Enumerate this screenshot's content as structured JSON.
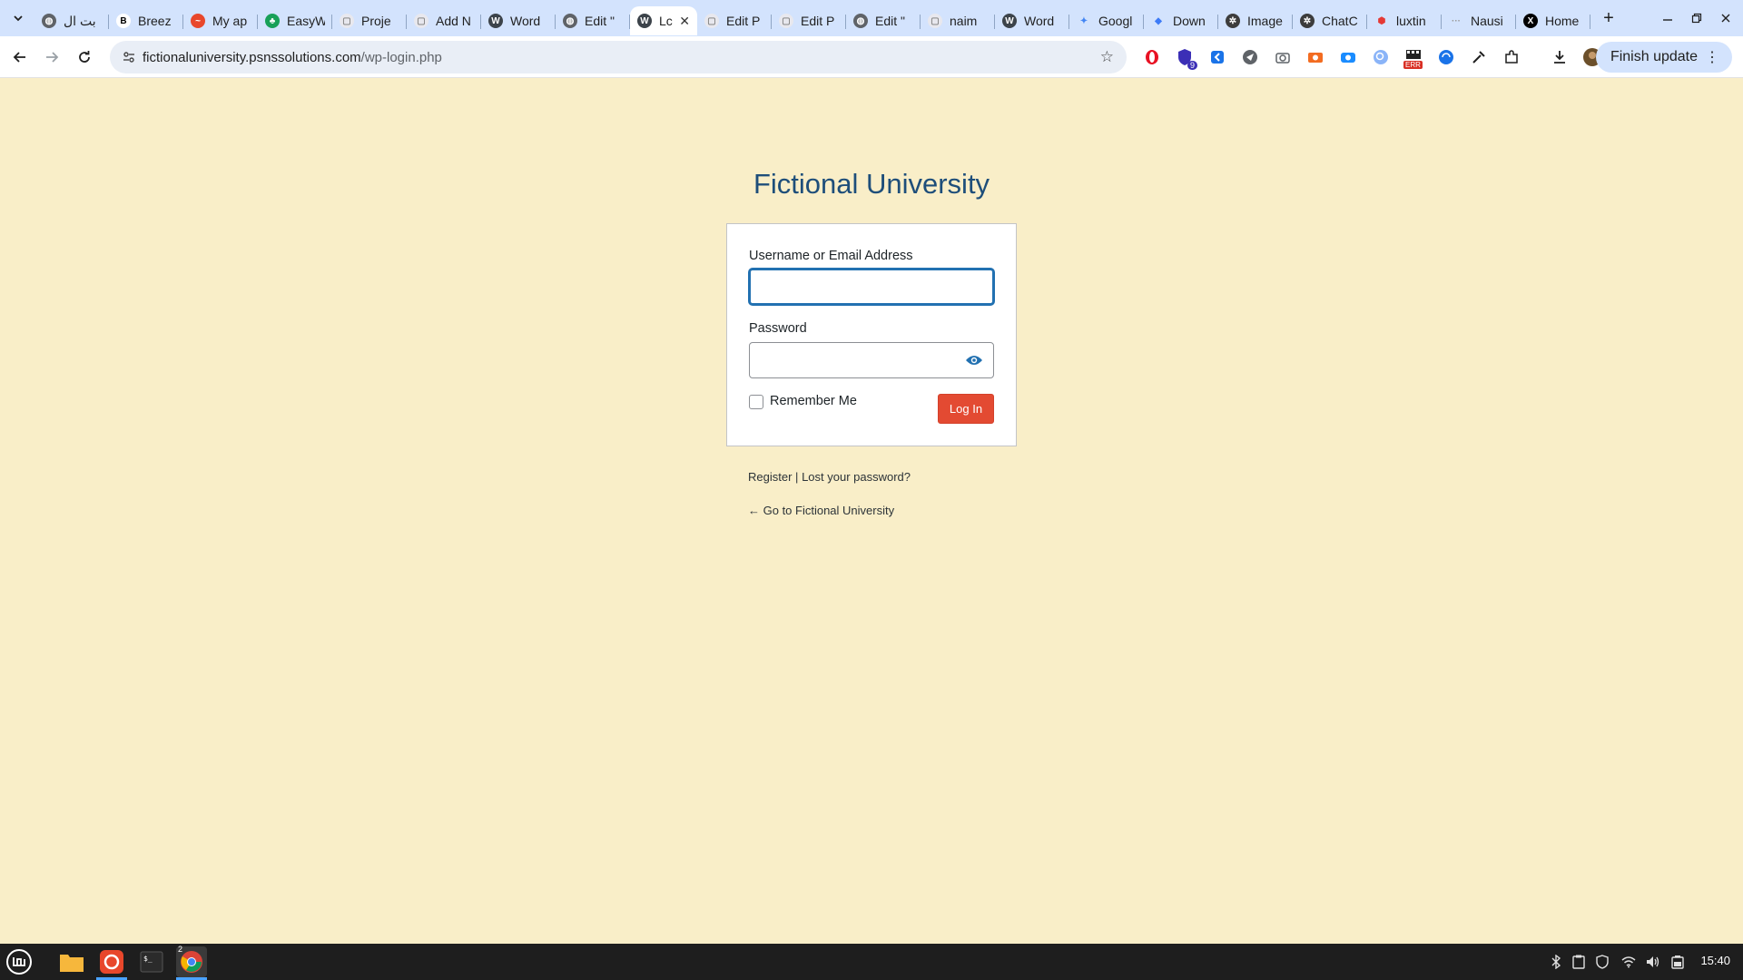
{
  "browser": {
    "tabs": [
      {
        "label": "بت ال",
        "favicon": "globe-icon"
      },
      {
        "label": "Breez",
        "favicon": "b-icon"
      },
      {
        "label": "My ap",
        "favicon": "m-icon"
      },
      {
        "label": "EasyW",
        "favicon": "octopus-icon"
      },
      {
        "label": "Proje",
        "favicon": "page-icon"
      },
      {
        "label": "Add N",
        "favicon": "page-icon"
      },
      {
        "label": "Word",
        "favicon": "wordpress-icon"
      },
      {
        "label": "Edit \"",
        "favicon": "globe-icon"
      },
      {
        "label": "Lc",
        "favicon": "wordpress-icon",
        "active": true
      },
      {
        "label": "Edit P",
        "favicon": "page-icon"
      },
      {
        "label": "Edit P",
        "favicon": "page-icon"
      },
      {
        "label": "Edit \"",
        "favicon": "globe-icon"
      },
      {
        "label": "naim",
        "favicon": "page-icon"
      },
      {
        "label": "Word",
        "favicon": "wordpress-icon"
      },
      {
        "label": "Googl",
        "favicon": "gemini-icon"
      },
      {
        "label": "Down",
        "favicon": "dropbox-icon"
      },
      {
        "label": "Image",
        "favicon": "openai-icon"
      },
      {
        "label": "ChatC",
        "favicon": "openai-icon"
      },
      {
        "label": "luxtin",
        "favicon": "shield-icon"
      },
      {
        "label": "Nausi",
        "favicon": "dots-icon"
      },
      {
        "label": "Home",
        "favicon": "x-icon"
      }
    ],
    "url_host": "fictionaluniversity.psnssolutions.com",
    "url_path": "/wp-login.php",
    "finish_update_label": "Finish update",
    "ext_badge_count": "9",
    "ext_err_label": "ERR"
  },
  "page": {
    "site_title": "Fictional University",
    "username_label": "Username or Email Address",
    "username_value": "",
    "password_label": "Password",
    "password_value": "",
    "remember_label": "Remember Me",
    "login_button_label": "Log In",
    "register_link": "Register",
    "separator": "|",
    "lost_password_link": "Lost your password?",
    "back_link": "← Go to Fictional University"
  },
  "taskbar": {
    "clock": "15:40",
    "chrome_badge": "2"
  },
  "colors": {
    "page_background": "#f9eec8",
    "title_color": "#1e4e7a",
    "login_button": "#e34a32",
    "focus_border": "#2271b1",
    "tabstrip": "#d3e3fd"
  }
}
